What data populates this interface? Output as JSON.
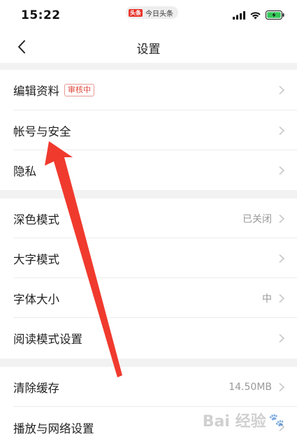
{
  "status_bar": {
    "time": "15:22",
    "app_badge": "头条",
    "app_name": "今日头条"
  },
  "nav": {
    "title": "设置"
  },
  "sections": [
    {
      "items": [
        {
          "label": "编辑资料",
          "badge": "审核中"
        },
        {
          "label": "帐号与安全"
        },
        {
          "label": "隐私"
        }
      ]
    },
    {
      "items": [
        {
          "label": "深色模式",
          "value": "已关闭"
        },
        {
          "label": "大字模式"
        },
        {
          "label": "字体大小",
          "value": "中"
        },
        {
          "label": "阅读模式设置"
        }
      ]
    },
    {
      "items": [
        {
          "label": "清除缓存",
          "value": "14.50MB"
        },
        {
          "label": "播放与网络设置"
        }
      ]
    }
  ],
  "annotation": {
    "arrow_color": "#f03a2e"
  },
  "watermark": {
    "text": "Bai 经验",
    "paw": "🐾"
  },
  "colors": {
    "accent": "#e8332a",
    "section_gap": "#f2f2f2",
    "divider": "#ececec",
    "secondary_text": "#999999"
  }
}
